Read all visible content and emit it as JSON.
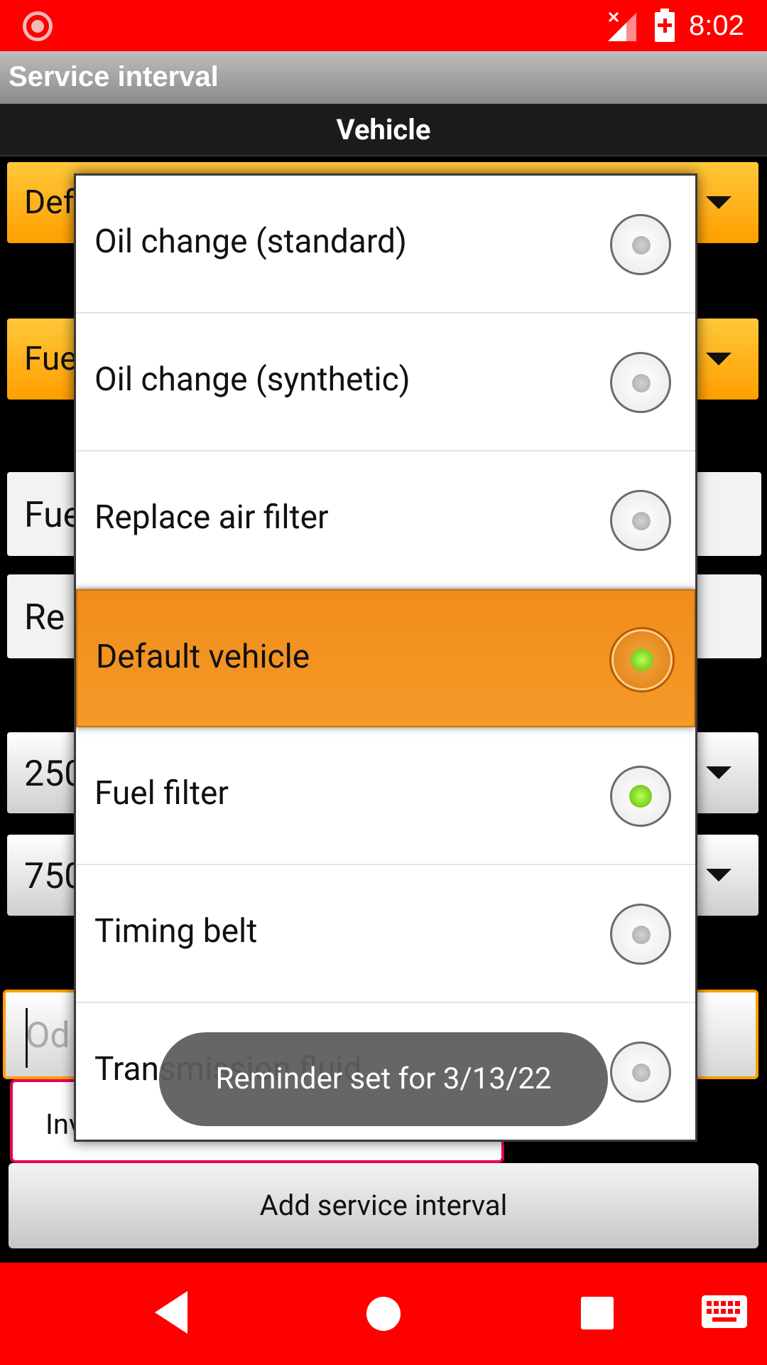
{
  "status_bar": {
    "time": "8:02",
    "icons": [
      "record-icon",
      "signal-off-icon",
      "battery-charging-icon"
    ],
    "background_color": "#ff0000"
  },
  "app_bar": {
    "title": "Service interval"
  },
  "section": {
    "title": "Vehicle"
  },
  "background_form": {
    "vehicle_spinner_partial": "Def",
    "type_spinner_partial": "Fue",
    "name_field_partial": "Fue",
    "description_field_partial": "Re",
    "interval1_partial": "250",
    "interval2_partial": "750",
    "odometer_placeholder_partial": "Od",
    "inv_partial": "Inv",
    "add_button_label": "Add service interval",
    "accent_color": "#ffa000"
  },
  "dialog": {
    "options": [
      {
        "label": "Oil change (standard)",
        "checked": false,
        "highlighted": false
      },
      {
        "label": "Oil change (synthetic)",
        "checked": false,
        "highlighted": false
      },
      {
        "label": "Replace air filter",
        "checked": false,
        "highlighted": false
      },
      {
        "label": "Default vehicle",
        "checked": true,
        "highlighted": true
      },
      {
        "label": "Fuel filter",
        "checked": true,
        "highlighted": false
      },
      {
        "label": "Timing belt",
        "checked": false,
        "highlighted": false
      },
      {
        "label": "Transmission fluid",
        "checked": false,
        "highlighted": false
      }
    ],
    "highlight_color": "#f39a28"
  },
  "toast": {
    "message": "Reminder set for 3/13/22"
  },
  "nav_bar": {
    "icons": [
      "back-icon",
      "home-icon",
      "recents-icon",
      "keyboard-icon"
    ]
  }
}
